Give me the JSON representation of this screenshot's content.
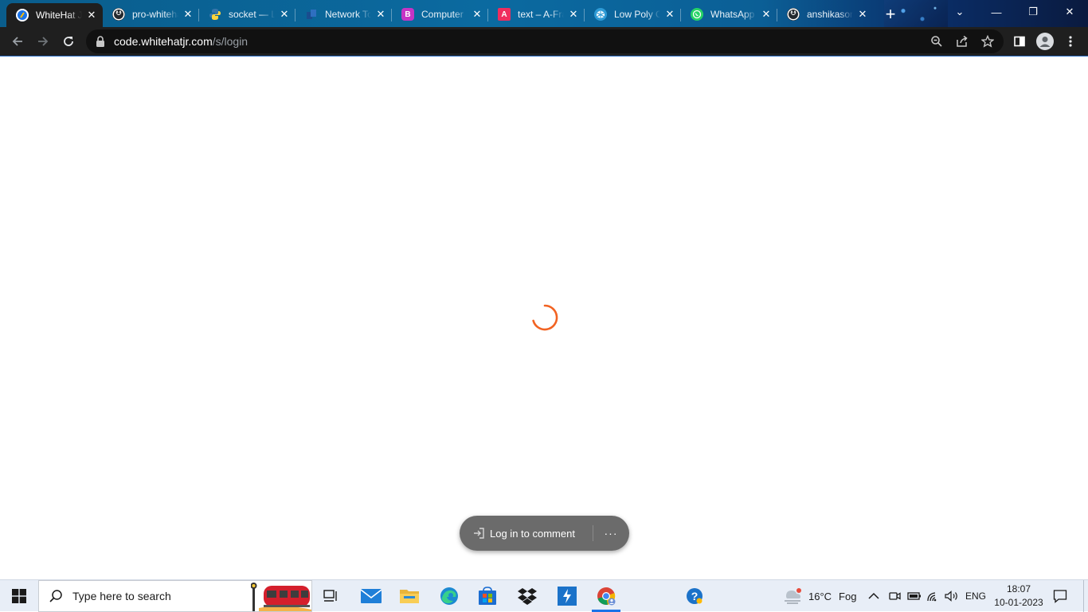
{
  "browser": {
    "tabs": [
      {
        "title": "WhiteHat Jr",
        "favicon": "whitehat-icon",
        "color": "#1a73e8",
        "active": true
      },
      {
        "title": "pro-whitehat",
        "favicon": "github-icon",
        "color": "#24292e",
        "active": false
      },
      {
        "title": "socket — Low",
        "favicon": "python-icon",
        "color": "#3776ab",
        "active": false
      },
      {
        "title": "Network Tools",
        "favicon": "network-icon",
        "color": "#2b5797",
        "active": false
      },
      {
        "title": "Computer",
        "favicon": "bootstrap-icon",
        "color": "#c534c5",
        "active": false
      },
      {
        "title": "text – A-Frame",
        "favicon": "aframe-icon",
        "color": "#ef2d5e",
        "active": false
      },
      {
        "title": "Low Poly Cart",
        "favicon": "lowpoly-icon",
        "color": "#2e9bd6",
        "active": false
      },
      {
        "title": "WhatsApp",
        "favicon": "whatsapp-icon",
        "color": "#25d366",
        "active": false
      },
      {
        "title": "anshikasoni",
        "favicon": "github-icon",
        "color": "#24292e",
        "active": false
      }
    ],
    "new_tab_label": "+",
    "window_controls": {
      "tab_search": "⌄",
      "minimize": "—",
      "restore": "❐",
      "close": "✕"
    },
    "address": {
      "host": "code.whitehatjr.com",
      "path": "/s/login"
    },
    "toolbar_icons": [
      "zoom-icon",
      "share-icon",
      "bookmark-star-icon",
      "side-panel-icon",
      "profile-icon",
      "menu-icon"
    ]
  },
  "page": {
    "spinner_color": "#f26322",
    "comment_pill": {
      "label": "Log in to comment",
      "more": "···"
    }
  },
  "taskbar": {
    "search_placeholder": "Type here to search",
    "apps": [
      "task-view-icon",
      "mail-icon",
      "file-explorer-icon",
      "edge-icon",
      "store-icon",
      "dropbox-icon",
      "powerbi-icon",
      "chrome-icon",
      "help-icon"
    ],
    "weather": {
      "temp": "16°C",
      "condition": "Fog"
    },
    "language": "ENG",
    "time": "18:07",
    "date": "10-01-2023"
  }
}
